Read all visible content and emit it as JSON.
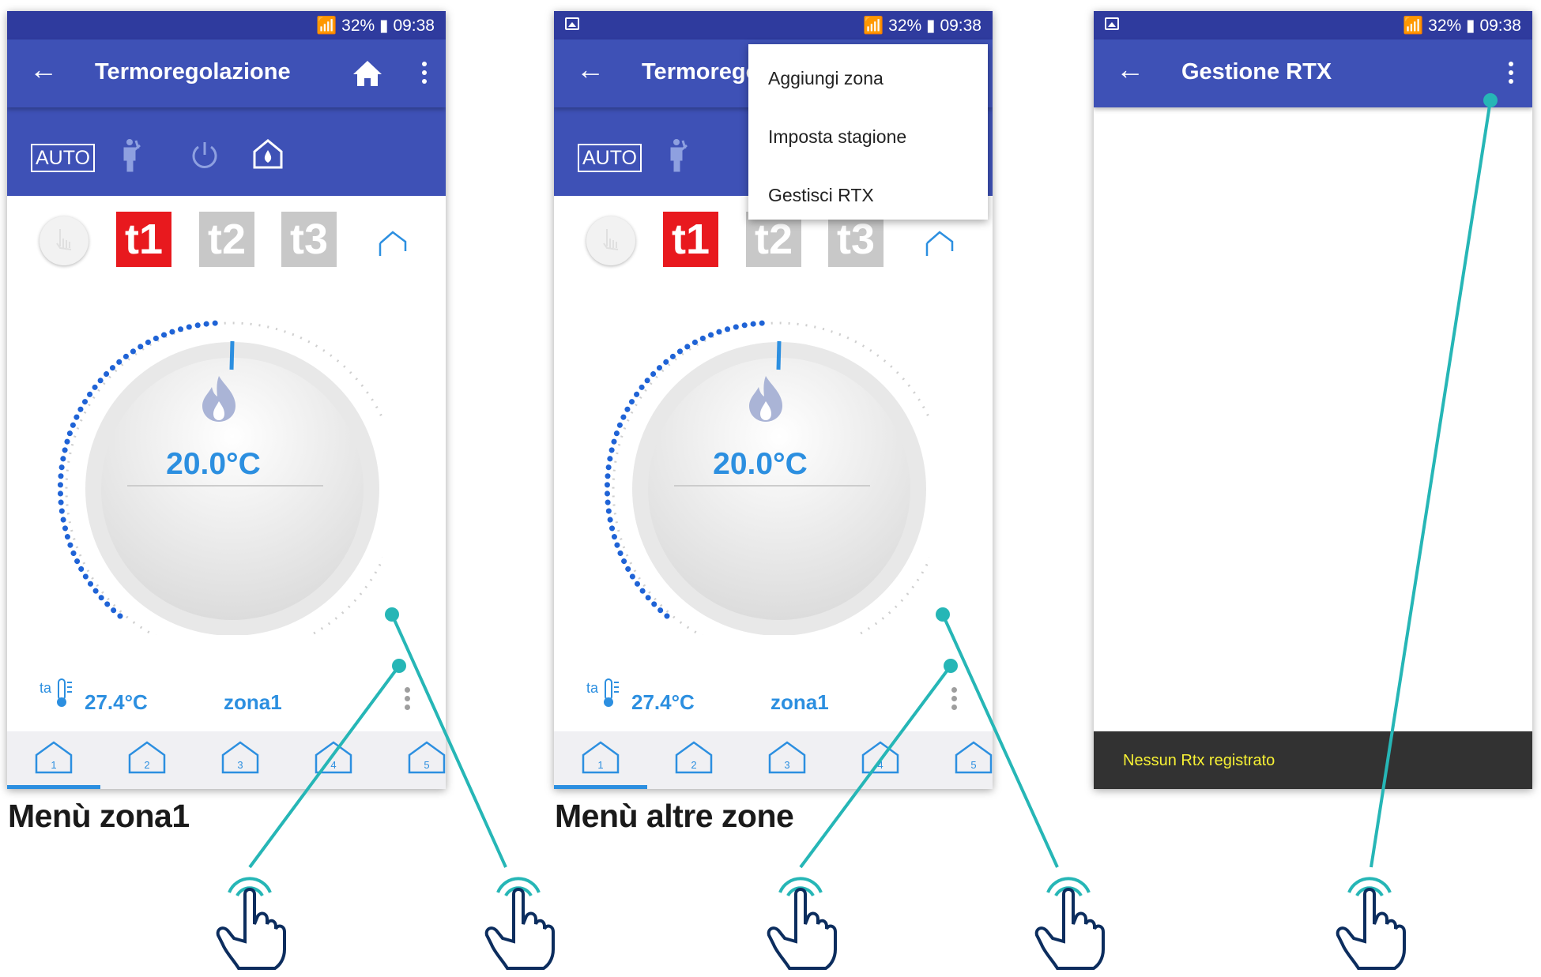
{
  "colors": {
    "primary": "#3e51b6",
    "status_bar": "#2f3b9e",
    "accent": "#2c8fe0",
    "teal": "#26b6b6",
    "t1_red": "#e8191e",
    "snack_text": "#f7f134"
  },
  "status": {
    "signal": "32%",
    "time": "09:38"
  },
  "phone1": {
    "title": "Termoregolazione",
    "mode": "AUTO",
    "programs": [
      "t1",
      "t2",
      "t3"
    ],
    "setpoint": "20.0°C",
    "ta_label": "ta",
    "ambient_temp": "27.4°C",
    "zone_name": "zona1",
    "tabs": [
      "1",
      "2",
      "3",
      "4",
      "5"
    ],
    "caption": "Menù zona1"
  },
  "phone2": {
    "title": "Termoregolazione",
    "mode": "AUTO",
    "programs": [
      "t1",
      "t2",
      "t3"
    ],
    "setpoint": "20.0°C",
    "ta_label": "ta",
    "ambient_temp": "27.4°C",
    "zone_name": "zona1",
    "tabs": [
      "1",
      "2",
      "3",
      "4",
      "5"
    ],
    "menu": [
      "Aggiungi zona",
      "Imposta stagione",
      "Gestisci RTX"
    ],
    "caption": "Menù altre zone"
  },
  "phone3": {
    "title": "Gestione RTX",
    "snackbar": "Nessun Rtx registrato"
  },
  "icons": [
    "back-arrow-icon",
    "home-icon",
    "more-vert-icon",
    "auto-mode-icon",
    "manual-person-icon",
    "power-icon",
    "boost-home-icon",
    "hand-icon",
    "zone-home-icon",
    "flame-icon",
    "thermometer-icon",
    "tap-hand-icon"
  ]
}
